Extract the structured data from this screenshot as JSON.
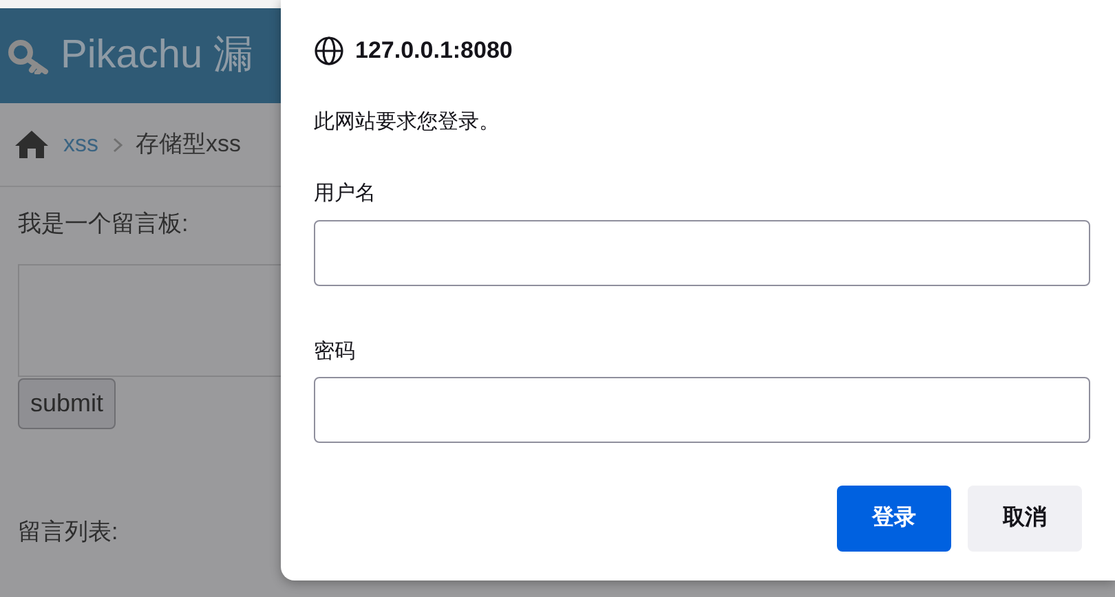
{
  "page": {
    "header": {
      "title": "Pikachu 漏"
    },
    "breadcrumb": [
      {
        "label": "xss",
        "kind": "link"
      },
      {
        "label": "存储型xss",
        "kind": "current"
      }
    ],
    "board_label": "我是一个留言板:",
    "submit_button": "submit",
    "list_label": "留言列表:"
  },
  "dialog": {
    "host": "127.0.0.1:8080",
    "message": "此网站要求您登录。",
    "fields": [
      {
        "label": "用户名"
      },
      {
        "label": "密码"
      }
    ],
    "buttons": [
      {
        "label": "登录",
        "kind": "primary"
      },
      {
        "label": "取消",
        "kind": "secondary"
      }
    ]
  }
}
